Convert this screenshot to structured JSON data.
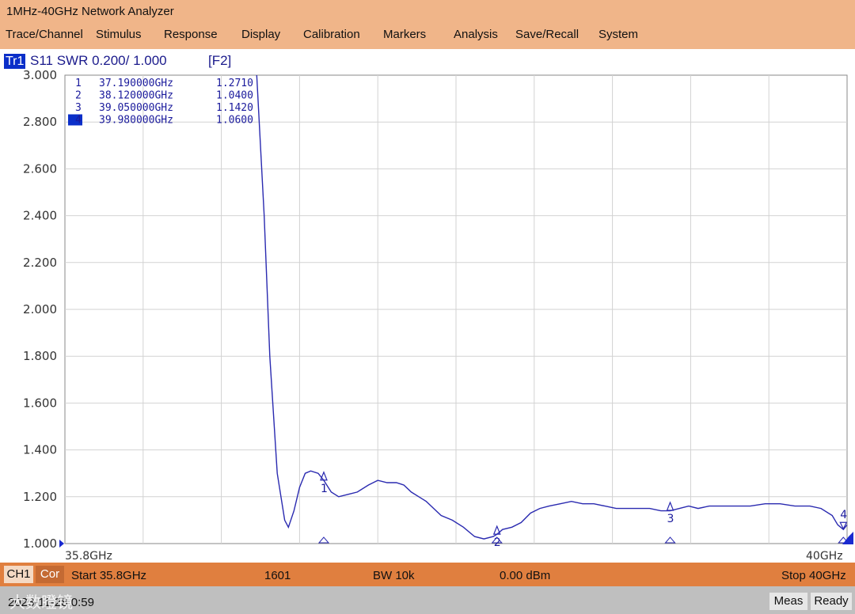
{
  "window": {
    "title": "1MHz-40GHz Network Analyzer"
  },
  "menu": [
    "Trace/Channel",
    "Stimulus",
    "Response",
    "Display",
    "Calibration",
    "Markers",
    "Analysis",
    "Save/Recall",
    "System"
  ],
  "trace": {
    "badge": "Tr1",
    "label": "S11 SWR 0.200/ 1.000",
    "window_tag": "[F2]"
  },
  "markers_table": [
    {
      "num": "1",
      "freq": "37.190000GHz",
      "value": "1.2710"
    },
    {
      "num": "2",
      "freq": "38.120000GHz",
      "value": "1.0400"
    },
    {
      "num": "3",
      "freq": "39.050000GHz",
      "value": "1.1420"
    },
    {
      "num": "4",
      "freq": "39.980000GHz",
      "value": "1.0600"
    }
  ],
  "chart_data": {
    "type": "line",
    "xlabel_left": "35.8GHz",
    "xlabel_right": "40GHz",
    "xlim": [
      35.8,
      40.0
    ],
    "ylim": [
      1.0,
      3.0
    ],
    "yticks": [
      "3.000",
      "2.800",
      "2.600",
      "2.400",
      "2.200",
      "2.000",
      "1.800",
      "1.600",
      "1.400",
      "1.200",
      "1.000"
    ],
    "grid": true,
    "line_color": "#2a2ab0",
    "series": [
      {
        "x": [
          36.83,
          36.87,
          36.9,
          36.94,
          36.98,
          37.0,
          37.03,
          37.06,
          37.09,
          37.12,
          37.16,
          37.19,
          37.23,
          37.27,
          37.32,
          37.37,
          37.43,
          37.48,
          37.53,
          37.58,
          37.62,
          37.66,
          37.7,
          37.74,
          37.78,
          37.82,
          37.88,
          37.94,
          38.0,
          38.05,
          38.1,
          38.12,
          38.15,
          38.2,
          38.25,
          38.3,
          38.35,
          38.4,
          38.46,
          38.52,
          38.58,
          38.64,
          38.7,
          38.76,
          38.82,
          38.88,
          38.94,
          39.0,
          39.05,
          39.1,
          39.15,
          39.2,
          39.26,
          39.32,
          39.4,
          39.48,
          39.56,
          39.64,
          39.72,
          39.8,
          39.86,
          39.92,
          39.95,
          39.98,
          40.0
        ],
        "values": [
          3.0,
          2.4,
          1.8,
          1.3,
          1.1,
          1.07,
          1.14,
          1.24,
          1.3,
          1.31,
          1.3,
          1.27,
          1.22,
          1.2,
          1.21,
          1.22,
          1.25,
          1.27,
          1.26,
          1.26,
          1.25,
          1.22,
          1.2,
          1.18,
          1.15,
          1.12,
          1.1,
          1.07,
          1.03,
          1.02,
          1.03,
          1.04,
          1.06,
          1.07,
          1.09,
          1.13,
          1.15,
          1.16,
          1.17,
          1.18,
          1.17,
          1.17,
          1.16,
          1.15,
          1.15,
          1.15,
          1.15,
          1.14,
          1.14,
          1.15,
          1.16,
          1.15,
          1.16,
          1.16,
          1.16,
          1.16,
          1.17,
          1.17,
          1.16,
          1.16,
          1.15,
          1.12,
          1.08,
          1.06,
          1.08
        ]
      }
    ],
    "markers": [
      {
        "label": "1",
        "x": 37.19,
        "y": 1.271
      },
      {
        "label": "2",
        "x": 38.12,
        "y": 1.04
      },
      {
        "label": "3",
        "x": 39.05,
        "y": 1.142
      },
      {
        "label": "4",
        "x": 39.98,
        "y": 1.06
      }
    ]
  },
  "channel_bar": {
    "channel": "CH1",
    "cor": "Cor",
    "start": "Start 35.8GHz",
    "points": "1601",
    "bw": "BW 10k",
    "power": "0.00 dBm",
    "stop": "Stop 40GHz"
  },
  "status_bar": {
    "datetime": "2023-11-28 0:59",
    "watermark": "大数瞪镜",
    "meas": "Meas",
    "ready": "Ready"
  }
}
